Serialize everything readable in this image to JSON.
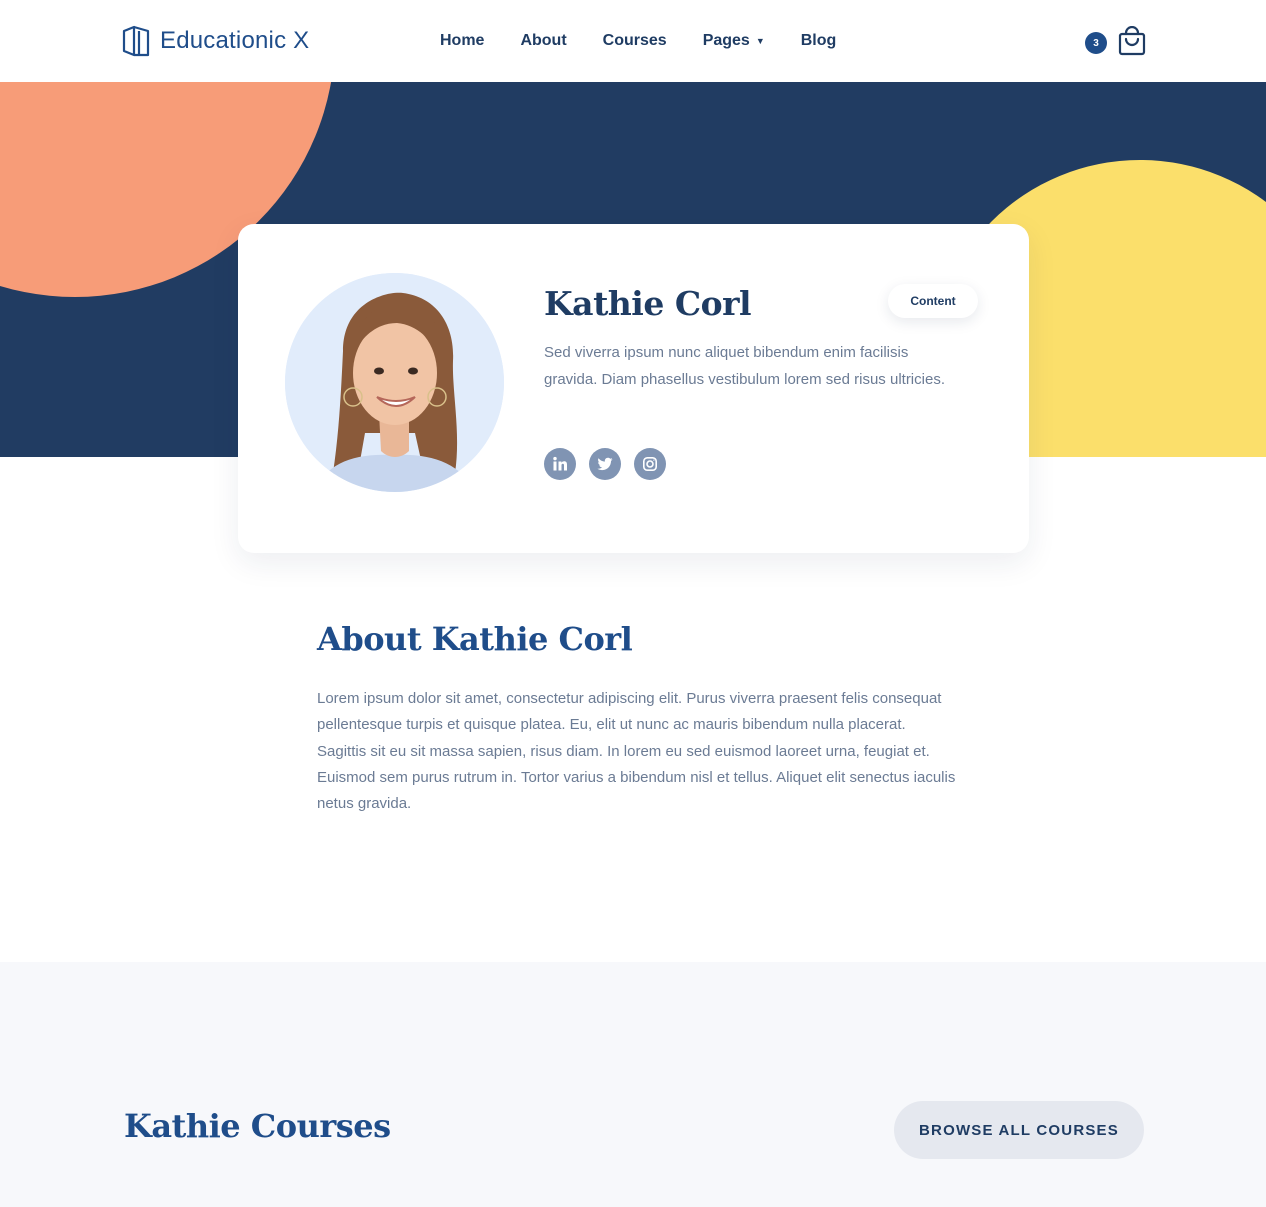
{
  "header": {
    "logo_text": "Educationic X",
    "logo_icon": "book-icon",
    "nav": [
      {
        "label": "Home"
      },
      {
        "label": "About"
      },
      {
        "label": "Courses"
      },
      {
        "label": "Pages",
        "has_dropdown": true
      },
      {
        "label": "Blog"
      }
    ],
    "cart_count": "3",
    "cart_icon": "shopping-bag-icon"
  },
  "colors": {
    "primary": "#1f4d8a",
    "hero_bg": "#213c62",
    "orange": "#f79c78",
    "yellow": "#fbdf6b",
    "social_bg": "#8094b3"
  },
  "profile": {
    "name": "Kathie Corl",
    "role": "Content",
    "bio": "Sed viverra ipsum nunc aliquet bibendum enim facilisis gravida. Diam phasellus vestibulum lorem sed risus ultricies.",
    "socials": [
      {
        "icon": "linkedin-icon"
      },
      {
        "icon": "twitter-icon"
      },
      {
        "icon": "instagram-icon"
      }
    ]
  },
  "about": {
    "title": "About Kathie Corl",
    "text": "Lorem ipsum dolor sit amet, consectetur adipiscing elit. Purus viverra praesent felis consequat pellentesque turpis et quisque platea. Eu, elit ut nunc ac mauris bibendum nulla placerat. Sagittis sit eu sit massa sapien, risus diam. In lorem eu sed euismod laoreet urna, feugiat et. Euismod sem purus rutrum in. Tortor varius a bibendum nisl et tellus. Aliquet elit senectus iaculis netus gravida."
  },
  "courses": {
    "title": "Kathie Courses",
    "browse_label": "BROWSE ALL COURSES"
  }
}
